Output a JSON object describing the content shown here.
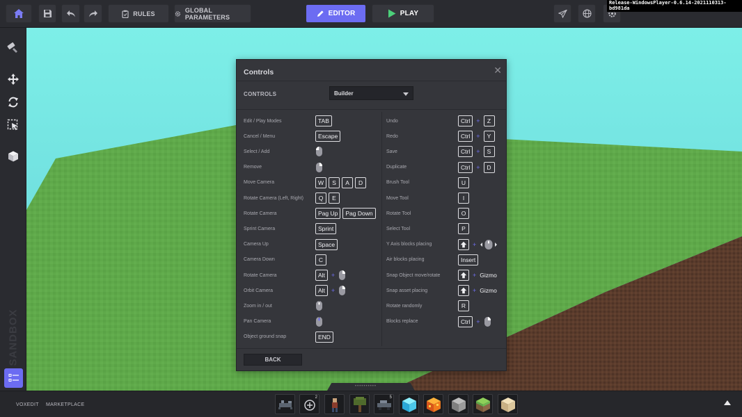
{
  "app": {
    "build": "Release-WindowsPlayer-0.6.14-2021110313-bd981da"
  },
  "topbar": {
    "rules_label": "RULES",
    "global_params_label": "GLOBAL PARAMETERS",
    "editor_label": "EDITOR",
    "play_label": "PLAY"
  },
  "sidebar": {
    "logo_text": "SANDBOX"
  },
  "dialog": {
    "title": "Controls",
    "controls_label": "CONTROLS",
    "mode_value": "Builder",
    "back_label": "BACK",
    "left": [
      {
        "label": "Edit / Play Modes",
        "keys": [
          "TAB"
        ]
      },
      {
        "label": "Cancel / Menu",
        "keys": [
          "Escape"
        ]
      },
      {
        "label": "Select / Add",
        "mouse": "left"
      },
      {
        "label": "Remove",
        "mouse": "right"
      },
      {
        "label": "Move Camera",
        "keys": [
          "W",
          "S",
          "A",
          "D"
        ]
      },
      {
        "label": "Rotate Camera (Left, Right)",
        "keys": [
          "Q",
          "E"
        ]
      },
      {
        "label": "Rotate Camera",
        "keys": [
          "Pag Up",
          "Pag Down"
        ]
      },
      {
        "label": "Sprint Camera",
        "keys": [
          "Sprint"
        ]
      },
      {
        "label": "Camera Up",
        "keys": [
          "Space"
        ]
      },
      {
        "label": "Camera Down",
        "keys": [
          "C"
        ]
      },
      {
        "label": "Rotate Camera",
        "keys": [
          "Alt",
          "+",
          "mouse-right"
        ]
      },
      {
        "label": "Orbit Camera",
        "keys": [
          "Alt",
          "+",
          "mouse-right"
        ]
      },
      {
        "label": "Zoom in / out",
        "mouse": "wheel"
      },
      {
        "label": "Pan Camera",
        "mouse": "middle"
      },
      {
        "label": "Object ground snap",
        "keys": [
          "END"
        ]
      }
    ],
    "right": [
      {
        "label": "Undo",
        "keys": [
          "Ctrl",
          "+",
          "Z"
        ]
      },
      {
        "label": "Redo",
        "keys": [
          "Ctrl",
          "+",
          "Y"
        ]
      },
      {
        "label": "Save",
        "keys": [
          "Ctrl",
          "+",
          "S"
        ]
      },
      {
        "label": "Duplicate",
        "keys": [
          "Ctrl",
          "+",
          "D"
        ]
      },
      {
        "label": "Brush Tool",
        "keys": [
          "U"
        ]
      },
      {
        "label": "Move Tool",
        "keys": [
          "I"
        ]
      },
      {
        "label": "Rotate Tool",
        "keys": [
          "O"
        ]
      },
      {
        "label": "Select Tool",
        "keys": [
          "P"
        ]
      },
      {
        "label": "Y Axis blocks placing",
        "keys": [
          "shift",
          "+",
          "mouse-scroll-lr"
        ]
      },
      {
        "label": "Air blocks placing",
        "keys": [
          "Insert"
        ]
      },
      {
        "label": "Snap Object move/rotate",
        "keys": [
          "shift",
          "+",
          "Gizmo"
        ]
      },
      {
        "label": "Snap asset placing",
        "keys": [
          "shift",
          "+",
          "Gizmo"
        ]
      },
      {
        "label": "Rotate randomly",
        "keys": [
          "R"
        ]
      },
      {
        "label": "Blocks replace",
        "keys": [
          "Ctrl",
          "+",
          "mouse-right"
        ]
      }
    ]
  },
  "bottombar": {
    "voxedit_label": "VOXEDIT",
    "marketplace_label": "MARKETPLACE",
    "hotbar": [
      {
        "icon": "scorpion-asset-icon",
        "count": ""
      },
      {
        "icon": "add-circle-icon",
        "count": "2"
      },
      {
        "icon": "character-asset-icon",
        "count": ""
      },
      {
        "icon": "tree-asset-icon",
        "count": ""
      },
      {
        "icon": "vehicle-asset-icon",
        "count": "5"
      },
      {
        "icon": "ice-block-icon",
        "count": ""
      },
      {
        "icon": "lava-block-icon",
        "count": ""
      },
      {
        "icon": "stone-block-icon",
        "count": ""
      },
      {
        "icon": "grass-block-icon",
        "count": ""
      },
      {
        "icon": "sand-block-icon",
        "count": ""
      }
    ]
  },
  "colors": {
    "accent": "#6c6cf2",
    "sky": "#6fe0de",
    "grass": "#5fa94a",
    "dirt": "#5a3a2a"
  }
}
